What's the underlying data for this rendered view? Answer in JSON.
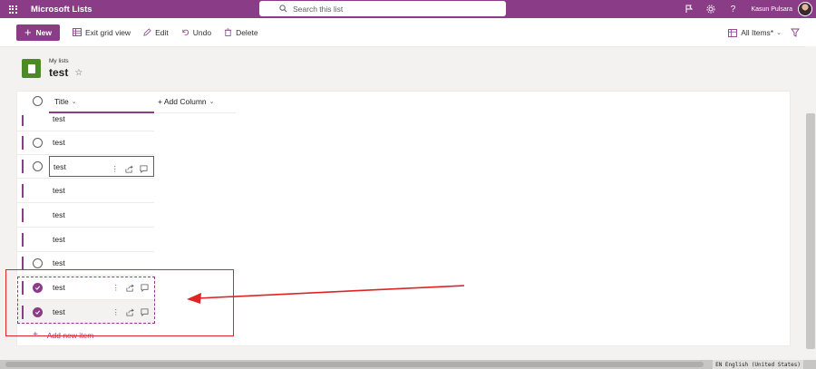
{
  "app": {
    "title": "Microsoft Lists"
  },
  "search": {
    "placeholder": "Search this list"
  },
  "user": {
    "name": "Kasun Pulsara"
  },
  "toolbar": {
    "new_label": "New",
    "exit_grid_label": "Exit grid view",
    "edit_label": "Edit",
    "undo_label": "Undo",
    "delete_label": "Delete",
    "view_label": "All Items*"
  },
  "page": {
    "breadcrumb": "My lists",
    "title": "test"
  },
  "grid": {
    "title_column": "Title",
    "add_column": "+ Add Column",
    "rows": [
      {
        "title": "test",
        "selected": false
      },
      {
        "title": "test",
        "selected": false
      },
      {
        "title": "test",
        "selected": false
      },
      {
        "title": "test",
        "selected": false
      },
      {
        "title": "test",
        "selected": false
      },
      {
        "title": "test",
        "selected": false
      },
      {
        "title": "test",
        "selected": false
      },
      {
        "title": "test",
        "selected": true
      },
      {
        "title": "test",
        "selected": true
      }
    ],
    "add_item": "Add new item"
  },
  "statusbar": {
    "language": "EN English (United States)"
  },
  "colors": {
    "brand": "#8b3c87",
    "annotation": "#e02424",
    "logo": "#4b8a24"
  }
}
